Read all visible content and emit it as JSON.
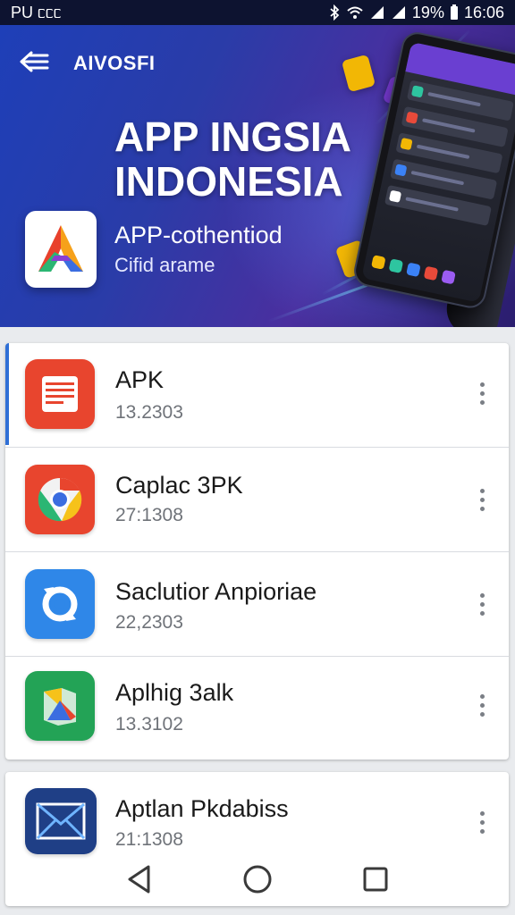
{
  "status_bar": {
    "carrier": "PU ᥴᥴᥴ",
    "battery": "19%",
    "time": "16:06"
  },
  "header": {
    "title": "AIVOSFI"
  },
  "hero": {
    "title_line1": "APP INGSIA",
    "title_line2": "INDONESIA",
    "subtitle": "APP-cothentiod",
    "tagline": "Cifid arame"
  },
  "apps": [
    {
      "name": "APK",
      "size": "13.2303",
      "icon": "notes-icon"
    },
    {
      "name": "Caplac 3PK",
      "size": "27:1308",
      "icon": "chrome-icon"
    },
    {
      "name": "Saclutior Anpioriae",
      "size": "22,2303",
      "icon": "sync-icon"
    },
    {
      "name": "Aplhig 3alk",
      "size": "13.3102",
      "icon": "map-icon"
    },
    {
      "name": "Aptlan Pkdabiss",
      "size": "21:1308",
      "icon": "mail-icon"
    }
  ],
  "nav": {
    "back": "back-triangle-icon",
    "home": "home-circle-icon",
    "recents": "recents-square-icon"
  },
  "colors": {
    "accent": "#2f6fd6",
    "status_bar": "#0d1330",
    "hero_start": "#1e3fb8",
    "hero_end": "#2a1d6e"
  }
}
